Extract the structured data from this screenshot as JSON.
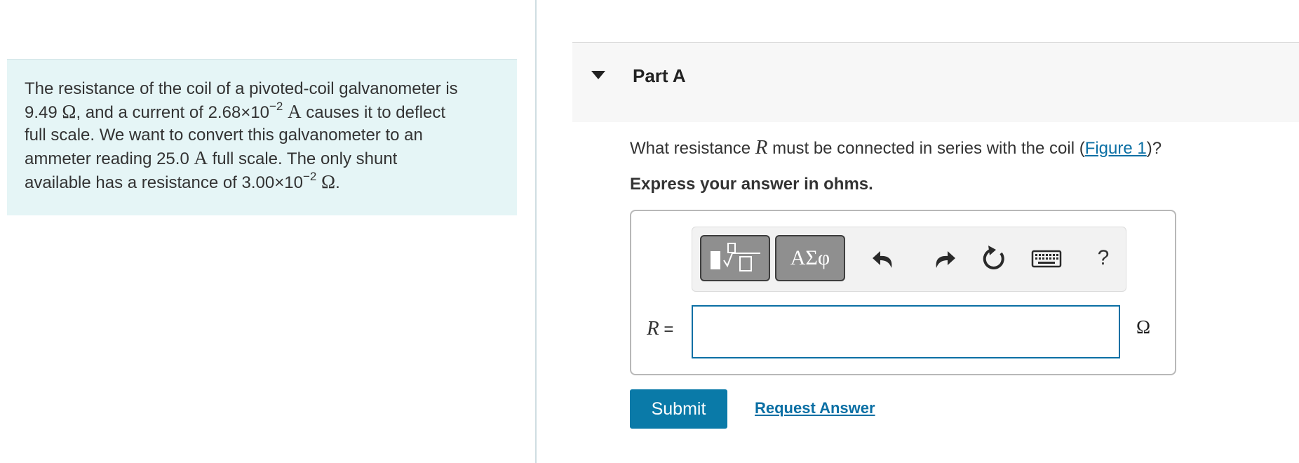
{
  "problem": {
    "line1": "The resistance of the coil of a pivoted-coil galvanometer is",
    "line2_value": "9.49",
    "ohm": "Ω",
    "line2_mid": ", and a current of 2.68×10",
    "line2_exp": "−2",
    "amp": "A",
    "line2_end": "causes it to deflect",
    "line3": "full scale. We want to convert this galvanometer to an",
    "line4_start": "ammeter reading 25.0",
    "line4_end": "full scale. The only shunt",
    "line5_start": "available has a resistance of 3.00×10",
    "line5_exp": "−2",
    "line5_end": "."
  },
  "part": {
    "title": "Part A"
  },
  "question": {
    "text_before": "What resistance",
    "variable": "R",
    "text_after": "must be connected in series with the coil (",
    "figure_link": "Figure 1",
    "text_end": ")?"
  },
  "instruction": "Express your answer in ohms.",
  "toolbar": {
    "symbols_label": "ΑΣφ",
    "help_label": "?"
  },
  "answer": {
    "variable": "R",
    "equals": "=",
    "value": "",
    "unit": "Ω"
  },
  "actions": {
    "submit_label": "Submit",
    "request_answer_label": "Request Answer"
  },
  "colors": {
    "accent": "#0a7aa8",
    "problem_bg": "#e5f5f6",
    "part_header_bg": "#f7f7f7"
  }
}
